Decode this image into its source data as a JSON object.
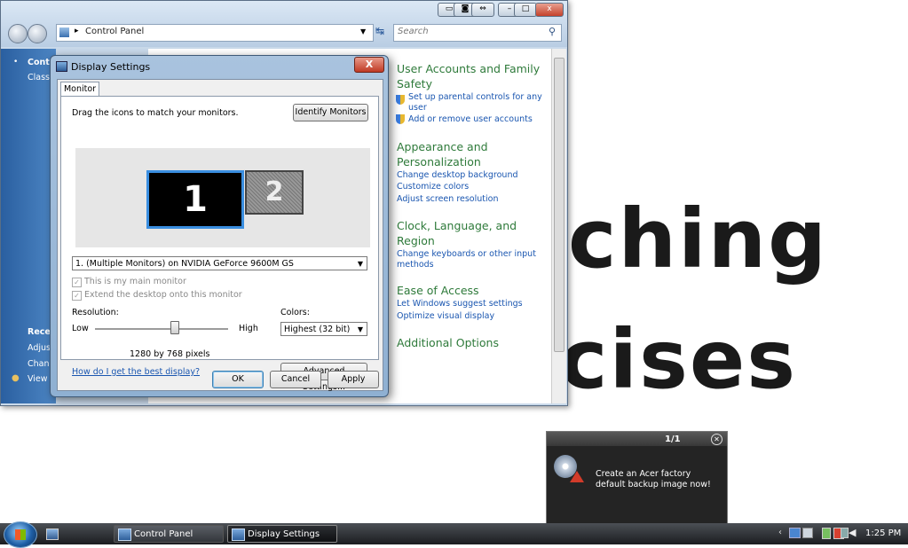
{
  "background": {
    "text_line1": "ching",
    "text_line2": "cises"
  },
  "control_panel": {
    "address": "Control Panel",
    "search_placeholder": "Search",
    "sidebar": {
      "item1": "Contr",
      "item2": "Classi",
      "recent_header": "Recer",
      "recent1": "Adjust",
      "recent2": "Chang",
      "recent3": "View"
    },
    "categories": [
      {
        "title_l1": "User Accounts and Family",
        "title_l2": "Safety",
        "links": [
          "Set up parental controls for any",
          "user",
          "Add or remove user accounts"
        ]
      },
      {
        "title_l1": "Appearance and",
        "title_l2": "Personalization",
        "links": [
          "Change desktop background",
          "Customize colors",
          "Adjust screen resolution"
        ]
      },
      {
        "title_l1": "Clock, Language, and",
        "title_l2": "Region",
        "links": [
          "Change keyboards or other input",
          "methods"
        ]
      },
      {
        "title_l1": "Ease of Access",
        "title_l2": "",
        "links": [
          "Let Windows suggest settings",
          "Optimize visual display"
        ]
      },
      {
        "title_l1": "Additional Options",
        "title_l2": "",
        "links": []
      }
    ]
  },
  "dialog": {
    "title": "Display Settings",
    "close": "X",
    "tab": "Monitor",
    "instruction": "Drag the icons to match your monitors.",
    "identify_button": "Identify Monitors",
    "monitor1": "1",
    "monitor2": "2",
    "display_select": "1. (Multiple Monitors) on NVIDIA GeForce 9600M GS",
    "check_main": "This is my main monitor",
    "check_extend": "Extend the desktop onto this monitor",
    "resolution_label": "Resolution:",
    "low": "Low",
    "high": "High",
    "resolution_value": "1280 by 768 pixels",
    "colors_label": "Colors:",
    "colors_select": "Highest (32 bit)",
    "help_link": "How do I get the best display?",
    "advanced_button": "Advanced Settings...",
    "ok": "OK",
    "cancel": "Cancel",
    "apply": "Apply"
  },
  "toast": {
    "counter": "1/1",
    "message": "Create an Acer factory default backup image now!"
  },
  "taskbar": {
    "btn1": "Control Panel",
    "btn2": "Display Settings",
    "time": "1:25 PM"
  }
}
